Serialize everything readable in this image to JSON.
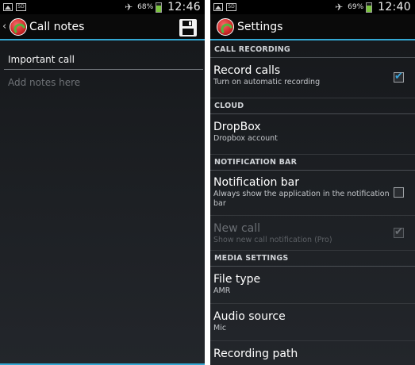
{
  "left_screen": {
    "status": {
      "battery": "68%",
      "battery_level": 0.68,
      "time": "12:46",
      "icons": [
        "gallery-icon",
        "sd-card-icon",
        "airplane-icon",
        "battery-icon"
      ]
    },
    "action_bar": {
      "back_glyph": "‹",
      "title": "Call notes",
      "save_icon": "save-icon"
    },
    "note_title_value": "Important call",
    "notes_placeholder": "Add notes here"
  },
  "right_screen": {
    "status": {
      "battery": "69%",
      "battery_level": 0.69,
      "time": "12:40"
    },
    "action_bar": {
      "title": "Settings"
    },
    "sections": [
      {
        "header": "CALL RECORDING",
        "items": [
          {
            "title": "Record calls",
            "summary": "Turn on automatic recording",
            "checkbox": true,
            "checked": true,
            "enabled": true
          }
        ]
      },
      {
        "header": "CLOUD",
        "items": [
          {
            "title": "DropBox",
            "summary": "Dropbox account"
          }
        ]
      },
      {
        "header": "NOTIFICATION BAR",
        "items": [
          {
            "title": "Notification bar",
            "summary": "Always show the application in the notification bar",
            "checkbox": true,
            "checked": false,
            "enabled": true
          },
          {
            "title": "New call",
            "summary": "Show new call notification (Pro)",
            "checkbox": true,
            "checked": true,
            "enabled": false
          }
        ]
      },
      {
        "header": "MEDIA SETTINGS",
        "items": [
          {
            "title": "File type",
            "summary": "AMR"
          },
          {
            "title": "Audio source",
            "summary": "Mic"
          },
          {
            "title": "Recording path",
            "summary": ""
          }
        ]
      }
    ]
  },
  "colors": {
    "accent": "#34a8d3",
    "checkbox_check": "#3aa5dc",
    "battery_green": "#7ac43d",
    "logo_red": "#d12b2b"
  }
}
